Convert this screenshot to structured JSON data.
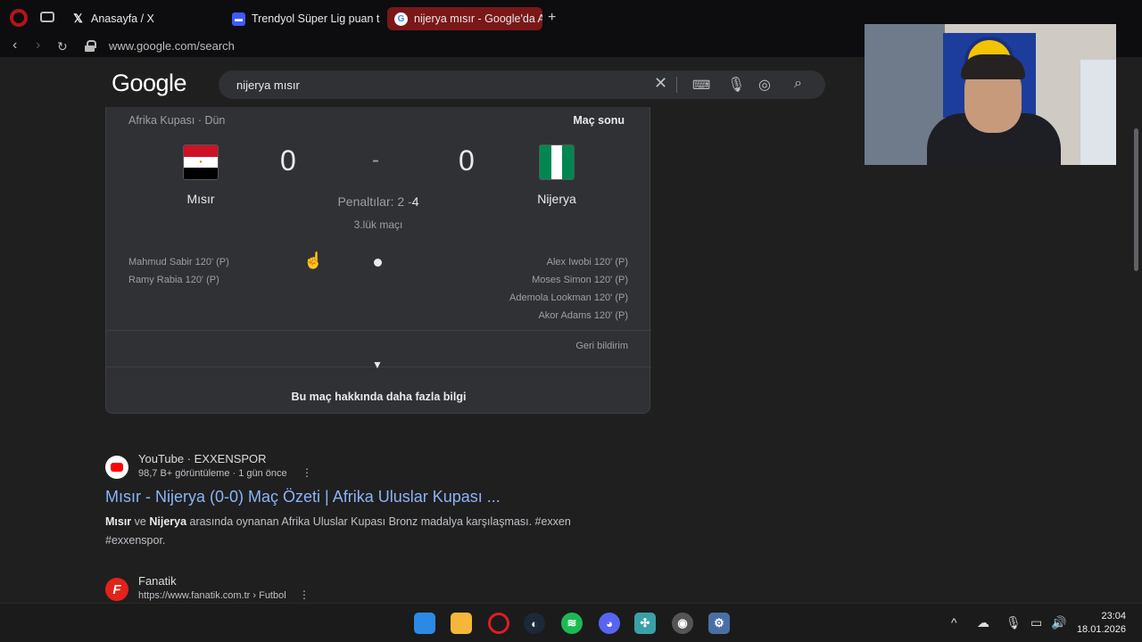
{
  "browser": {
    "tabs": [
      {
        "label": "Anasayfa / X",
        "favicon": "x-icon"
      },
      {
        "label": "Trendyol Süper Lig puan t",
        "favicon": "trendyol-icon"
      },
      {
        "label": "nijerya mısır - Google'da A",
        "favicon": "google-icon",
        "active": true
      }
    ],
    "new_tab": "+",
    "url": "www.google.com/search"
  },
  "google": {
    "logo": "Google",
    "query": "nijerya mısır"
  },
  "match": {
    "league": "Afrika Kupası · Dün",
    "status": "Maç sonu",
    "home_team": "Mısır",
    "away_team": "Nijerya",
    "home_score": "0",
    "away_score": "0",
    "separator": "-",
    "penalties_label": "Penaltılar: 2 -",
    "penalties_away": "4",
    "stage": "3.lük maçı",
    "home_scorers": [
      "Mahmud Sabir 120' (P)",
      "Ramy Rabia 120' (P)"
    ],
    "away_scorers": [
      "Alex Iwobi 120' (P)",
      "Moses Simon 120' (P)",
      "Ademola Lookman 120' (P)",
      "Akor Adams 120' (P)"
    ],
    "feedback": "Geri bildirim",
    "more_info": "Bu maç hakkında daha fazla bilgi"
  },
  "results": [
    {
      "source": "YouTube · EXXENSPOR",
      "meta": "98,7 B+ görüntüleme · 1 gün önce",
      "title": "Mısır - Nijerya (0-0) Maç Özeti | Afrika Uluslar Kupası ...",
      "snippet_a": "Mısır",
      "snippet_b": " ve ",
      "snippet_c": "Nijerya",
      "snippet_d": " arasında oynanan Afrika Uluslar Kupası Bronz madalya karşılaşması. #exxen #exxenspor."
    },
    {
      "source": "Fanatik",
      "meta": "https://www.fanatik.com.tr › Futbol"
    }
  ],
  "taskbar": {
    "time": "23:04",
    "date": "18.01.2026"
  },
  "colors": {
    "active_tab": "#7a1717",
    "link": "#8ab4f8",
    "page_bg": "#1f1f1f"
  }
}
